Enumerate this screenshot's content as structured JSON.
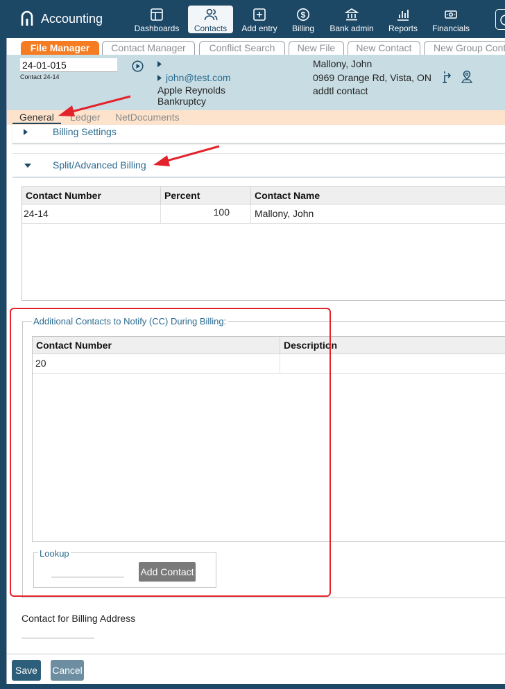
{
  "app": {
    "title": "Accounting"
  },
  "nav": [
    {
      "label": "Dashboards",
      "icon": "dashboard-icon"
    },
    {
      "label": "Contacts",
      "icon": "contacts-icon",
      "active": true
    },
    {
      "label": "Add entry",
      "icon": "add-entry-icon"
    },
    {
      "label": "Billing",
      "icon": "billing-icon"
    },
    {
      "label": "Bank admin",
      "icon": "bank-icon"
    },
    {
      "label": "Reports",
      "icon": "reports-icon"
    },
    {
      "label": "Financials",
      "icon": "financials-icon"
    }
  ],
  "tabs": [
    "File Manager",
    "Contact Manager",
    "Conflict Search",
    "New File",
    "New Contact",
    "New Group Cont"
  ],
  "file": {
    "number": "24-01-015",
    "contact_number_label": "Contact 24-14",
    "email": "john@test.com",
    "client": "Apple Reynolds",
    "matter_type": "Bankruptcy",
    "contact_name": "Mallony, John",
    "address": "0969 Orange Rd, Vista, ON",
    "extra": "addtl contact"
  },
  "subtabs": [
    "General",
    "Ledger",
    "NetDocuments"
  ],
  "sections": {
    "billing_settings": "Billing Settings",
    "split_billing": "Split/Advanced Billing"
  },
  "split_table": {
    "headers": [
      "Contact Number",
      "Percent",
      "Contact Name"
    ],
    "rows": [
      [
        "24-14",
        "100",
        "Mallony, John"
      ]
    ]
  },
  "cc": {
    "legend": "Additional Contacts to Notify (CC) During Billing:",
    "headers": [
      "Contact Number",
      "Description"
    ],
    "rows": [
      [
        "20",
        ""
      ]
    ],
    "lookup_legend": "Lookup",
    "add_button": "Add Contact"
  },
  "billing_address_label": "Contact for Billing Address",
  "buttons": {
    "save": "Save",
    "cancel": "Cancel"
  },
  "colors": {
    "topbar": "#1c4866",
    "active_tab": "#f57c22",
    "header_band": "#c8dde3",
    "subtab_band": "#fde3cc",
    "annotation": "#e3232b"
  }
}
